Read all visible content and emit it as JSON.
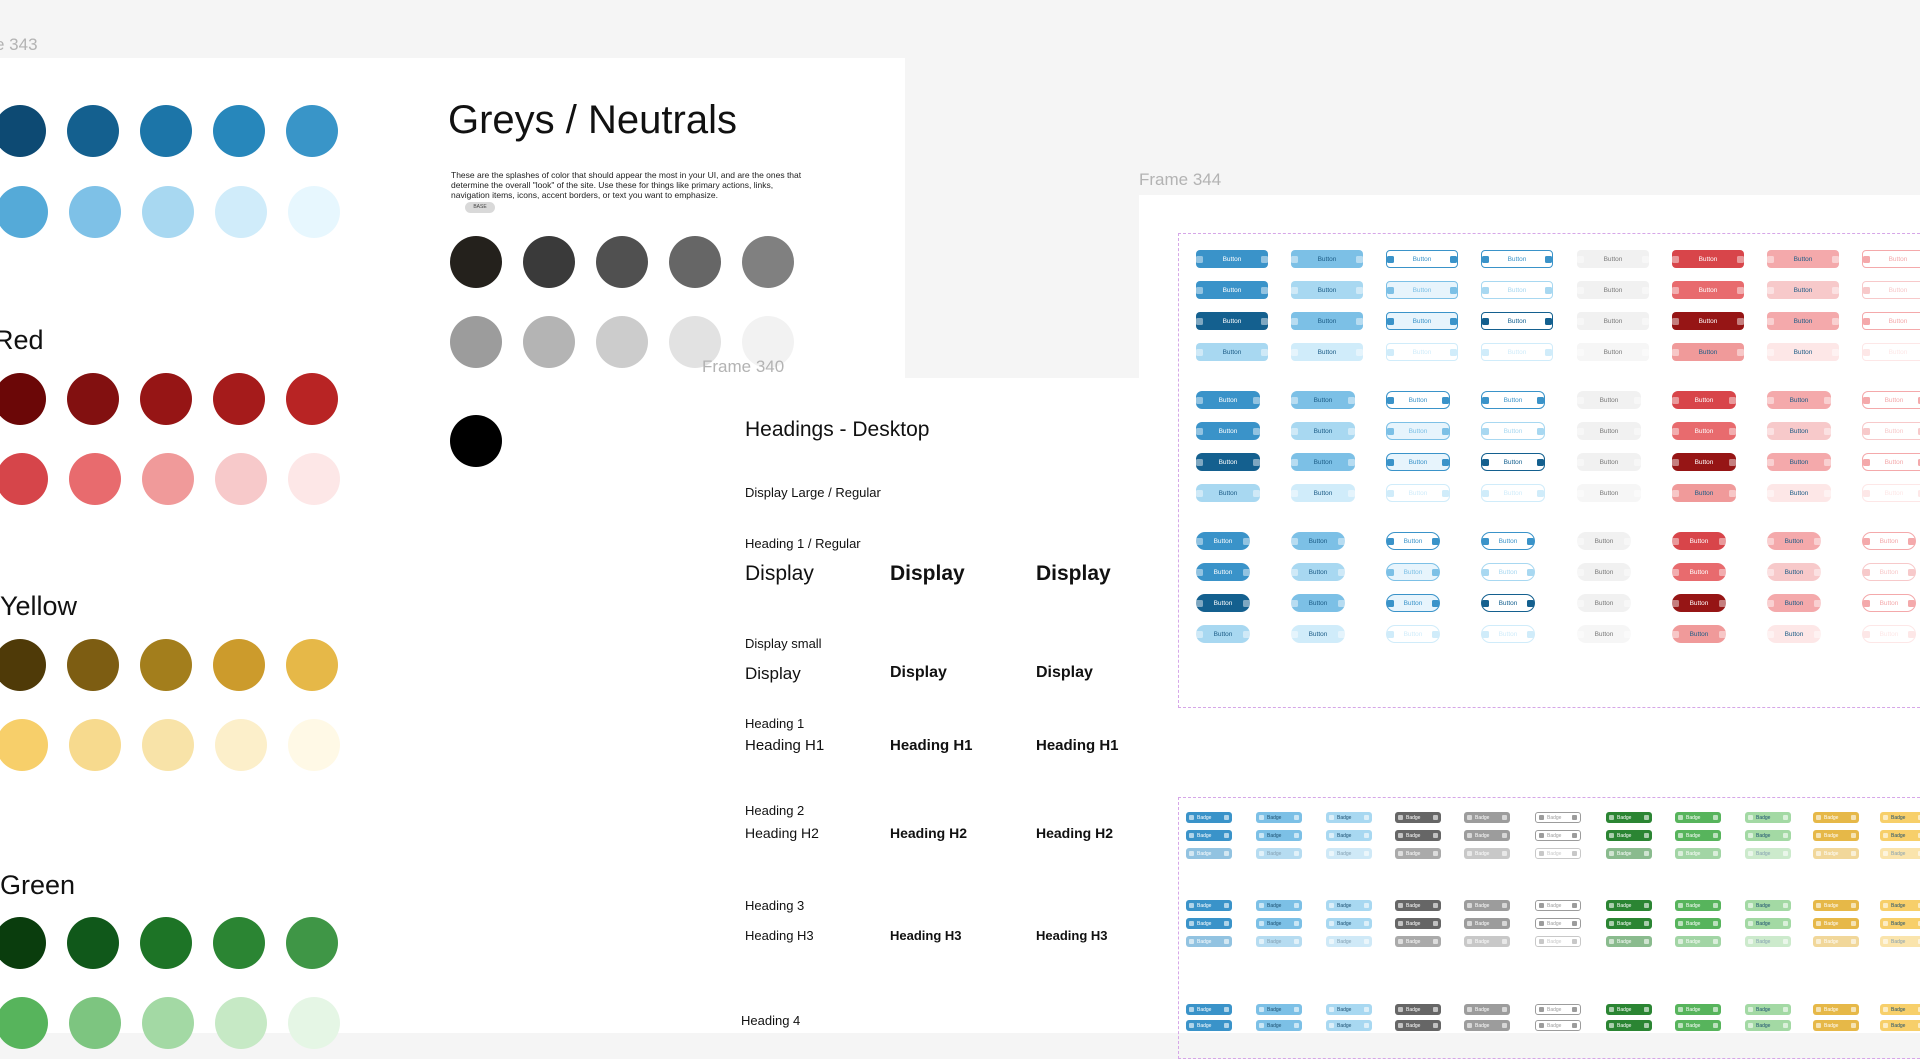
{
  "frames": {
    "left_label": "e 343",
    "right_label": "Frame 344",
    "mid_label": "Frame 340"
  },
  "palette": {
    "blue": {
      "title": "",
      "row1": [
        "#0d4a73",
        "#14608f",
        "#1c75a8",
        "#2787bb",
        "#3995c8"
      ],
      "row2": [
        "#55aad8",
        "#7ec1e7",
        "#a8d8f1",
        "#d0ecfa",
        "#e7f7fe"
      ]
    },
    "red": {
      "title": "Red",
      "row1": [
        "#6b0707",
        "#821010",
        "#961515",
        "#a51b1b",
        "#b82424"
      ],
      "row2": [
        "#d6454a",
        "#e86b6e",
        "#f09a9a",
        "#f7c9ca",
        "#fde7e7"
      ]
    },
    "yellow": {
      "title": "Yellow",
      "row1": [
        "#4f3a08",
        "#7d5d12",
        "#a37e1c",
        "#cc9b2c",
        "#e6b848"
      ],
      "row2": [
        "#f7cf6a",
        "#f7da8e",
        "#f8e3a8",
        "#fcefca",
        "#fff9e6"
      ]
    },
    "green": {
      "title": "Green",
      "row1": [
        "#0a3d0d",
        "#10581a",
        "#1d7426",
        "#2b8533",
        "#3f9646"
      ],
      "row2": [
        "#57b45c",
        "#7dc580",
        "#a3d9a4",
        "#c6e9c5",
        "#e5f6e5"
      ]
    }
  },
  "greys": {
    "title": "Greys / Neutrals",
    "description": "These are the splashes of color that should appear the most in your UI, and are the ones that determine the overall \"look\" of the site. Use these for things like primary actions, links, navigation items, icons, accent borders, or text you want to emphasize.",
    "base_label": "BASE",
    "row1": [
      "#24211c",
      "#3a3a3a",
      "#505050",
      "#666666",
      "#808080"
    ],
    "row2": [
      "#9c9c9c",
      "#b4b4b4",
      "#cccccc",
      "#e2e2e2",
      "#f2f2f2"
    ],
    "black": "#000000"
  },
  "headings": {
    "title": "Headings - Desktop",
    "display_large_label": "Display Large / Regular",
    "h1_regular_label": "Heading 1 / Regular",
    "display_samples": [
      "Display",
      "Display",
      "Display"
    ],
    "display_small_label": "Display small",
    "display_small_samples": [
      "Display",
      "Display",
      "Display"
    ],
    "heading1_label": "Heading 1",
    "heading1_samples": [
      "Heading H1",
      "Heading H1",
      "Heading H1"
    ],
    "heading2_label": "Heading 2",
    "heading2_samples": [
      "Heading H2",
      "Heading H2",
      "Heading H2"
    ],
    "heading3_label": "Heading 3",
    "heading3_samples": [
      "Heading H3",
      "Heading H3",
      "Heading H3"
    ],
    "heading4_label": "Heading 4"
  },
  "buttons": {
    "label": "Button",
    "columns": [
      [
        "#3a93c9",
        "#7cc0e6",
        "#ffffff|#3a93c9",
        "#ffffff|#3a93c9",
        "#f1f1f1",
        "#d8454a",
        "#f4a9ab",
        "#ffffff|#f4a9ab"
      ],
      [
        "#3a93c9",
        "#a8d8f1",
        "#e7f4fc|#7cc0e6",
        "#ffffff|#a8d8f1",
        "#f1f1f1",
        "#e86b6e",
        "#f7c9ca",
        "#ffffff|#f7c9ca"
      ],
      [
        "#14608f",
        "#7cc0e6",
        "#e7f4fc|#3a93c9",
        "#ffffff|#14608f",
        "#f1f1f1",
        "#961515",
        "#f4a9ab",
        "#ffffff|#f4a9ab"
      ],
      [
        "#a8d8f1",
        "#d0ecfa",
        "#ffffff|#d0ecfa",
        "#ffffff|#d0ecfa",
        "#f6f6f6",
        "#f09a9a",
        "#fde7e7",
        "#ffffff|#fde7e7"
      ]
    ]
  },
  "badges": {
    "label": "Badge",
    "colors": [
      "#3a93c9",
      "#7cc0e6",
      "#a8d8f1",
      "#666666",
      "#9c9c9c",
      "#ffffff|#9c9c9c",
      "#2b8533",
      "#57b45c",
      "#a3d9a4",
      "#e6b848",
      "#f7cf6a"
    ]
  }
}
